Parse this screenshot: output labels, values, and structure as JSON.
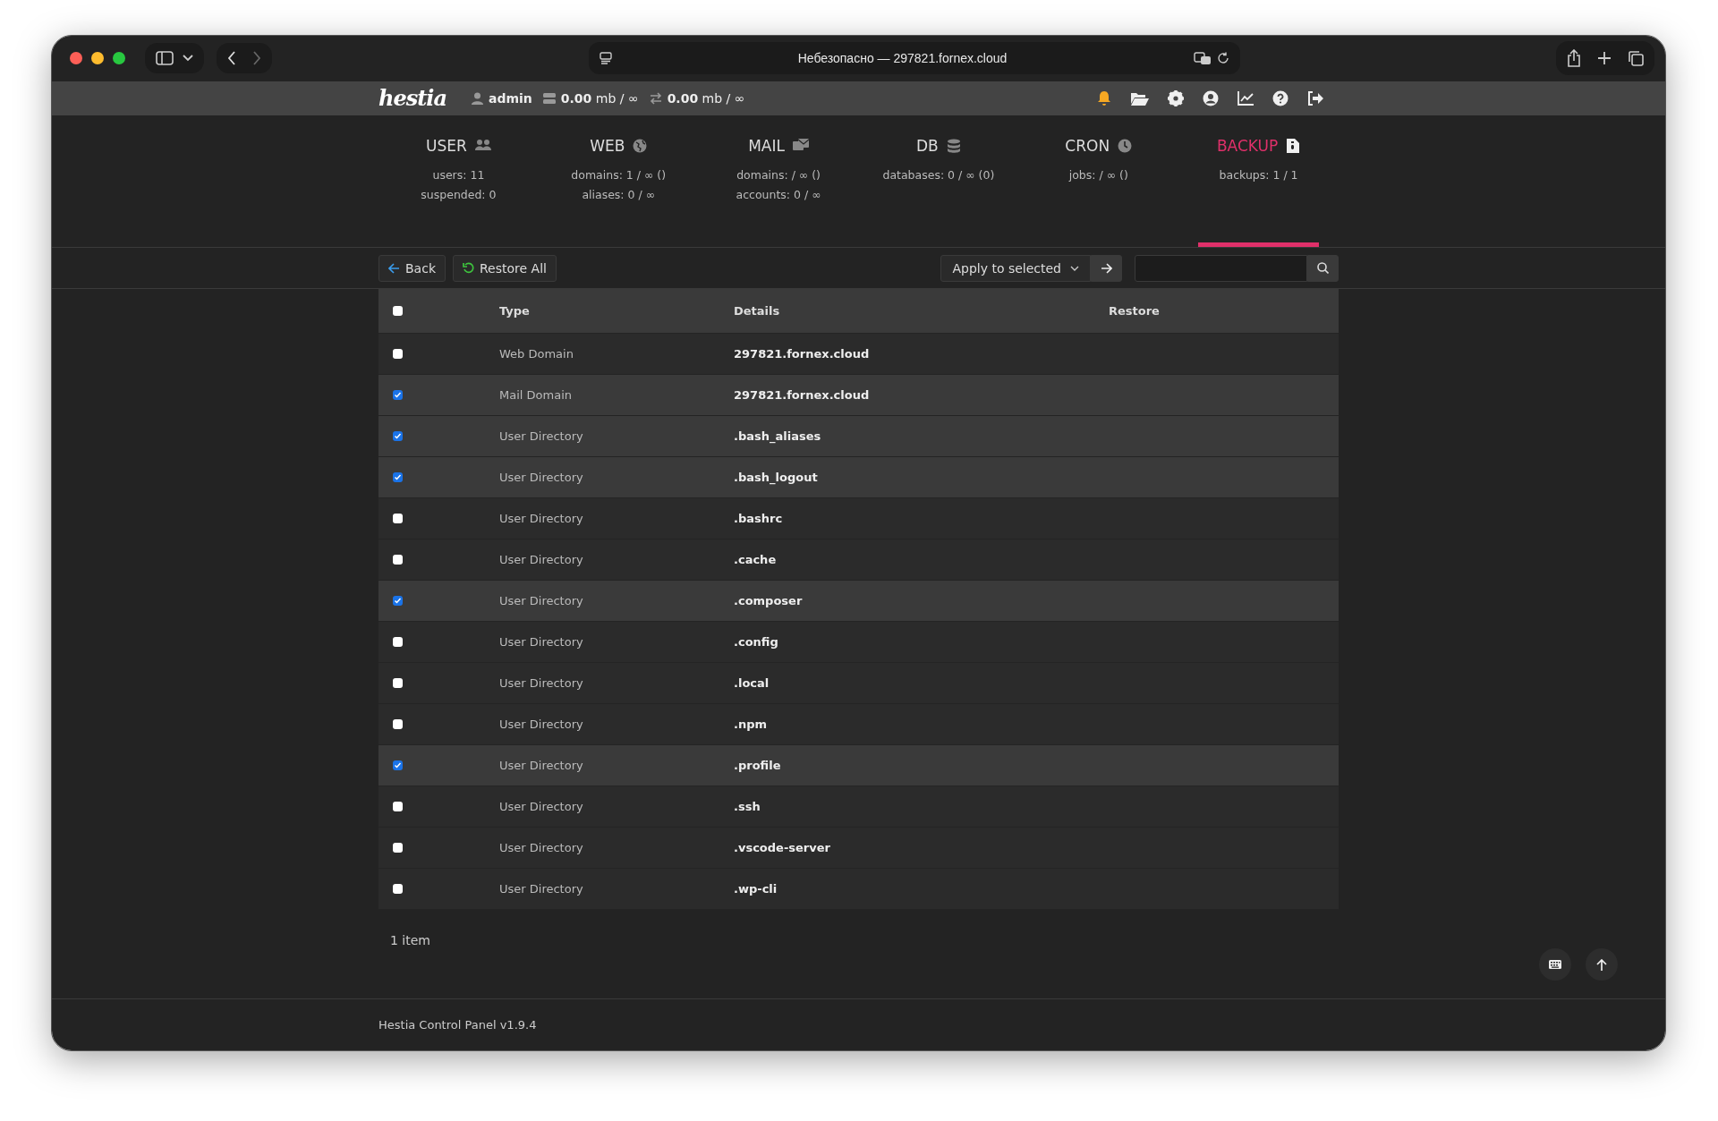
{
  "browser": {
    "address": "Небезопасно — 297821.fornex.cloud"
  },
  "topbar": {
    "logo": "hestia",
    "user": "admin",
    "disk": "**0.00** mb / ∞",
    "bandwidth": "**0.00** mb / ∞"
  },
  "stats": [
    {
      "kind": "user",
      "label": "USER",
      "selected": false,
      "lines": [
        "users: 11",
        "suspended: 0"
      ]
    },
    {
      "kind": "web",
      "label": "WEB",
      "selected": false,
      "lines": [
        "domains: 1 / ∞ ()",
        "aliases: 0 / ∞"
      ]
    },
    {
      "kind": "mail",
      "label": "MAIL",
      "selected": false,
      "lines": [
        "domains:  / ∞ ()",
        "accounts: 0 / ∞"
      ]
    },
    {
      "kind": "db",
      "label": "DB",
      "selected": false,
      "lines": [
        "databases: 0 / ∞ (0)"
      ]
    },
    {
      "kind": "cron",
      "label": "CRON",
      "selected": false,
      "lines": [
        "jobs:  / ∞ ()"
      ]
    },
    {
      "kind": "backup",
      "label": "BACKUP",
      "selected": true,
      "lines": [
        "backups: 1 / 1"
      ]
    }
  ],
  "toolbar": {
    "back": "Back",
    "restore_all": "Restore All",
    "apply": "Apply to selected"
  },
  "table": {
    "select_all": false,
    "columns": [
      "Type",
      "Details",
      "Restore"
    ],
    "rows": [
      {
        "type": "Web Domain",
        "details": "297821.fornex.cloud",
        "checked": false
      },
      {
        "type": "Mail Domain",
        "details": "297821.fornex.cloud",
        "checked": true
      },
      {
        "type": "User Directory",
        "details": ".bash_aliases",
        "checked": true
      },
      {
        "type": "User Directory",
        "details": ".bash_logout",
        "checked": true
      },
      {
        "type": "User Directory",
        "details": ".bashrc",
        "checked": false
      },
      {
        "type": "User Directory",
        "details": ".cache",
        "checked": false
      },
      {
        "type": "User Directory",
        "details": ".composer",
        "checked": true
      },
      {
        "type": "User Directory",
        "details": ".config",
        "checked": false
      },
      {
        "type": "User Directory",
        "details": ".local",
        "checked": false
      },
      {
        "type": "User Directory",
        "details": ".npm",
        "checked": false
      },
      {
        "type": "User Directory",
        "details": ".profile",
        "checked": true
      },
      {
        "type": "User Directory",
        "details": ".ssh",
        "checked": false
      },
      {
        "type": "User Directory",
        "details": ".vscode-server",
        "checked": false
      },
      {
        "type": "User Directory",
        "details": ".wp-cli",
        "checked": false
      }
    ]
  },
  "footer": {
    "count": "1 item",
    "version": "Hestia Control Panel v1.9.4"
  }
}
